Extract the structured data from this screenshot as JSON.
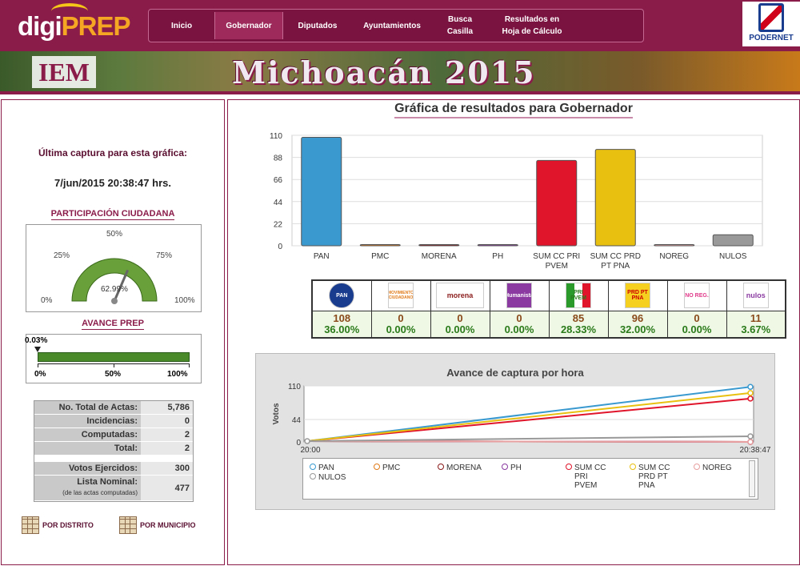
{
  "header": {
    "logo_digi": "digi",
    "logo_prep": "PREP",
    "nav": [
      {
        "label": "Inicio"
      },
      {
        "label": "Gobernador"
      },
      {
        "label": "Diputados"
      },
      {
        "label": "Ayuntamientos"
      },
      {
        "label": "Busca Casilla"
      },
      {
        "label": "Resultados en Hoja de Cálculo"
      }
    ],
    "brand": "PODERNET"
  },
  "banner": {
    "left_logo": "IEM",
    "title": "Michoacán 2015"
  },
  "left": {
    "last_capture_title": "Última captura para esta gráfica:",
    "last_capture_date": "7/jun/2015 20:38:47 hrs.",
    "participacion_title": "PARTICIPACIÓN CIUDADANA",
    "gauge": {
      "labels": [
        "0%",
        "25%",
        "50%",
        "75%",
        "100%"
      ],
      "value_label": "62.99%",
      "value": 62.99
    },
    "avance_title": "AVANCE PREP",
    "progress": {
      "value_label": "0.03%",
      "value": 0.03,
      "ticks": [
        "0%",
        "50%",
        "100%"
      ]
    },
    "stats": [
      {
        "k": "No. Total de Actas:",
        "v": "5,786"
      },
      {
        "k": "Incidencias:",
        "v": "0"
      },
      {
        "k": "Computadas:",
        "v": "2"
      },
      {
        "k": "Total:",
        "v": "2"
      },
      {
        "k": "Votos Ejercidos:",
        "v": "300"
      },
      {
        "k": "Lista Nominal:",
        "sub": "(de las actas computadas)",
        "v": "477"
      }
    ],
    "btn_distrito": "POR DISTRITO",
    "btn_municipio": "POR MUNICIPIO"
  },
  "main": {
    "title": "Gráfica de resultados para Gobernador",
    "table": [
      {
        "logo": "PAN",
        "votes": "108",
        "pct": "36.00%"
      },
      {
        "logo": "MOVIMIENTO CIUDADANO",
        "votes": "0",
        "pct": "0.00%"
      },
      {
        "logo": "morena",
        "votes": "0",
        "pct": "0.00%"
      },
      {
        "logo": "Humanista",
        "votes": "0",
        "pct": "0.00%"
      },
      {
        "logo": "PRI PVEM",
        "votes": "85",
        "pct": "28.33%"
      },
      {
        "logo": "PRD PT PNA",
        "votes": "96",
        "pct": "32.00%"
      },
      {
        "logo": "NO REG.",
        "votes": "0",
        "pct": "0.00%"
      },
      {
        "logo": "nulos",
        "votes": "11",
        "pct": "3.67%"
      }
    ],
    "line_title": "Avance de captura por hora"
  },
  "colors": {
    "PAN": "#3a9ad0",
    "PMC": "#e07b1a",
    "MORENA": "#8a1a1a",
    "PH": "#8a3aa0",
    "PRI": "#e0142a",
    "PRD": "#e8c010",
    "NOREG": "#e8a0a0",
    "NULOS": "#999999"
  },
  "chart_data": [
    {
      "type": "bar",
      "categories": [
        "PAN",
        "PMC",
        "MORENA",
        "PH",
        "SUM CC PRI PVEM",
        "SUM CC PRD PT PNA",
        "NOREG",
        "NULOS"
      ],
      "category_lines": [
        [
          "PAN"
        ],
        [
          "PMC"
        ],
        [
          "MORENA"
        ],
        [
          "PH"
        ],
        [
          "SUM CC PRI",
          "PVEM"
        ],
        [
          "SUM CC PRD",
          "PT PNA"
        ],
        [
          "NOREG"
        ],
        [
          "NULOS"
        ]
      ],
      "values": [
        108,
        0,
        0,
        0,
        85,
        96,
        0,
        11
      ],
      "colors": [
        "#3a9ad0",
        "#e07b1a",
        "#8a1a1a",
        "#8a3aa0",
        "#e0142a",
        "#e8c010",
        "#e8a0a0",
        "#999999"
      ],
      "yticks": [
        "0",
        "22",
        "44",
        "66",
        "88",
        "110"
      ],
      "ylim": [
        0,
        110
      ],
      "grid": true
    },
    {
      "type": "line",
      "title": "Avance de captura por hora",
      "ylabel": "Votos",
      "xticks": [
        "20:00",
        "20:38:47"
      ],
      "yticks": [
        "0",
        "44",
        "110"
      ],
      "ylim": [
        0,
        110
      ],
      "grid": true,
      "series": [
        {
          "name": "PAN",
          "color": "#3a9ad0",
          "values": [
            0,
            108
          ]
        },
        {
          "name": "PMC",
          "color": "#e07b1a",
          "values": [
            0,
            0
          ]
        },
        {
          "name": "MORENA",
          "color": "#8a1a1a",
          "values": [
            0,
            0
          ]
        },
        {
          "name": "PH",
          "color": "#8a3aa0",
          "values": [
            0,
            0
          ]
        },
        {
          "name": "SUM CC PRI PVEM",
          "label_lines": [
            "SUM CC",
            "PRI",
            "PVEM"
          ],
          "color": "#e0142a",
          "values": [
            0,
            85
          ]
        },
        {
          "name": "SUM CC PRD PT PNA",
          "label_lines": [
            "SUM CC",
            "PRD PT",
            "PNA"
          ],
          "color": "#e8c010",
          "values": [
            0,
            96
          ]
        },
        {
          "name": "NOREG",
          "color": "#e8a0a0",
          "values": [
            0,
            0
          ]
        },
        {
          "name": "NULOS",
          "color": "#999999",
          "values": [
            0,
            11
          ]
        }
      ]
    }
  ]
}
